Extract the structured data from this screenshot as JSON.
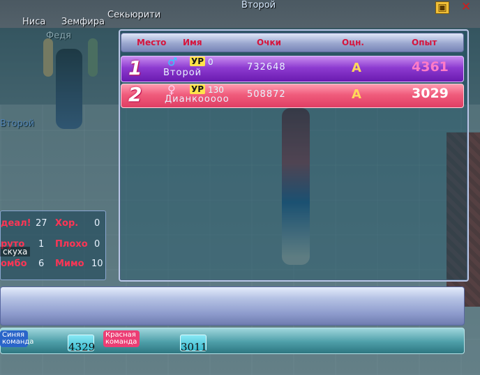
{
  "scene": {
    "nametags": [
      "Ниса",
      "Земфира",
      "Секьюрити",
      "Федя",
      "Второй"
    ],
    "top_player": "Второй"
  },
  "results": {
    "headers": {
      "place": "Место",
      "name": "Имя",
      "score": "Очки",
      "grade": "Оцн.",
      "exp": "Опыт"
    },
    "rows": [
      {
        "rank": "1",
        "gender": "♂",
        "level_label": "УР",
        "level": "0",
        "name": "Второй",
        "score": "732648",
        "grade": "A",
        "exp": "4361"
      },
      {
        "rank": "2",
        "gender": "♀",
        "level_label": "УР",
        "level": "130",
        "name": "Дианкооооо",
        "score": "508872",
        "grade": "A",
        "exp": "3029"
      }
    ]
  },
  "stats": {
    "items": [
      {
        "label": "деал!",
        "value": "27"
      },
      {
        "label": "Хор.",
        "value": "0"
      },
      {
        "label": "руто",
        "value": "1"
      },
      {
        "label": "Плохо",
        "value": "0"
      },
      {
        "label": "омбо",
        "value": "6"
      },
      {
        "label": "Мимо",
        "value": "10"
      }
    ],
    "chat": "скуха"
  },
  "teams": {
    "blue_label": "Синяя команда",
    "blue_score": "4329",
    "red_label": "Красная команда",
    "red_score": "3011"
  },
  "icons": {
    "save": "floppy-disk-icon",
    "close": "close-icon"
  }
}
